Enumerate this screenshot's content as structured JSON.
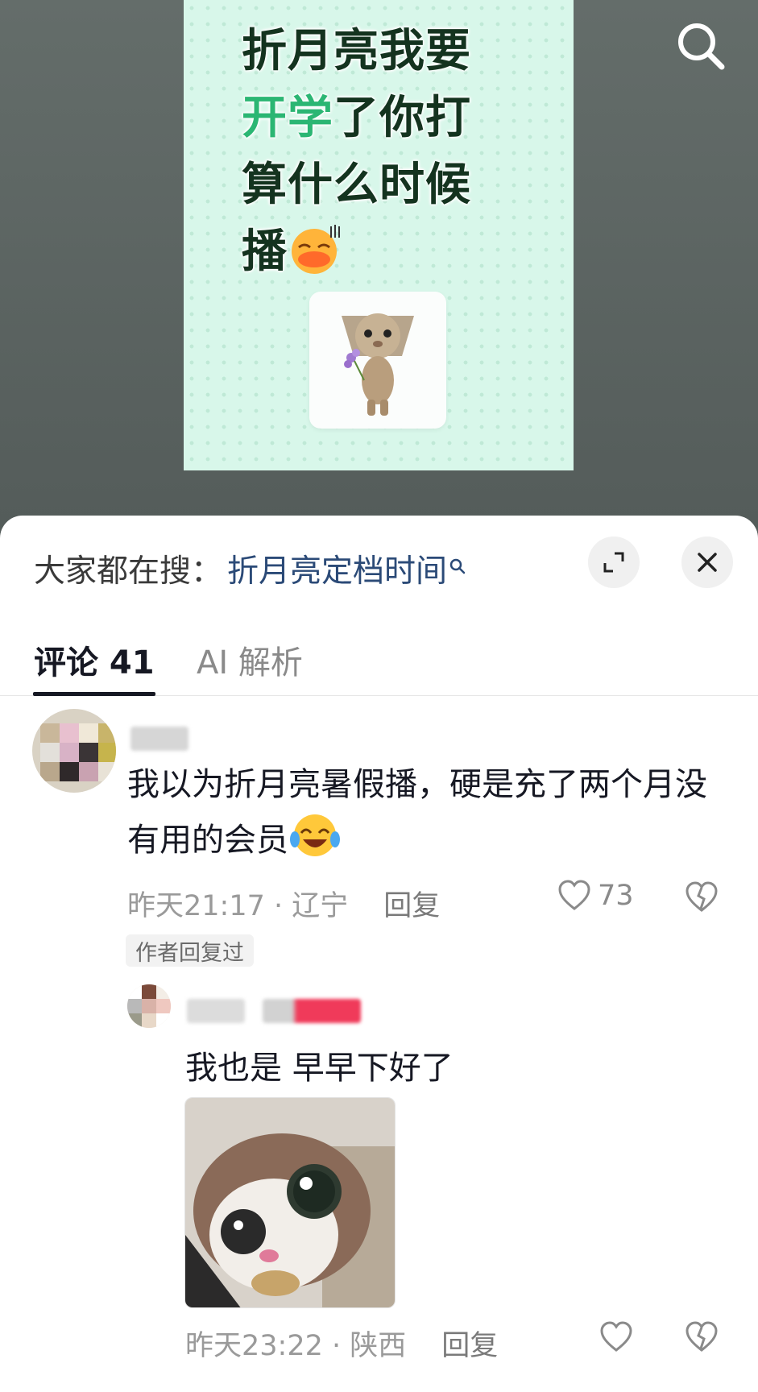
{
  "post": {
    "title_line1": "折月亮我要",
    "title_hl": "开学",
    "title_rest2": "了你打",
    "title_line3": "算什么时候",
    "title_line4": "播"
  },
  "icons": {
    "search": "search-icon",
    "expand": "expand-icon",
    "close": "close-icon",
    "like": "heart-icon",
    "dislike": "broken-heart-icon"
  },
  "trend": {
    "label": "大家都在搜：",
    "query": "折月亮定档时间",
    "q_mark": "Q"
  },
  "tabs": {
    "comments": "评论 41",
    "ai": "AI 解析"
  },
  "comments": [
    {
      "text": "我以为折月亮暑假播，硬是充了两个月没有用的会员",
      "time_location": "昨天21:17 · 辽宁",
      "reply_label": "回复",
      "likes": "73",
      "badge": "作者回复过"
    },
    {
      "text": "我也是 早早下好了",
      "time_location": "昨天23:22 · 陕西",
      "reply_label": "回复"
    }
  ],
  "colors": {
    "accent_green": "#2bb673",
    "link_blue": "#2b4a77",
    "text_primary": "#161823"
  }
}
